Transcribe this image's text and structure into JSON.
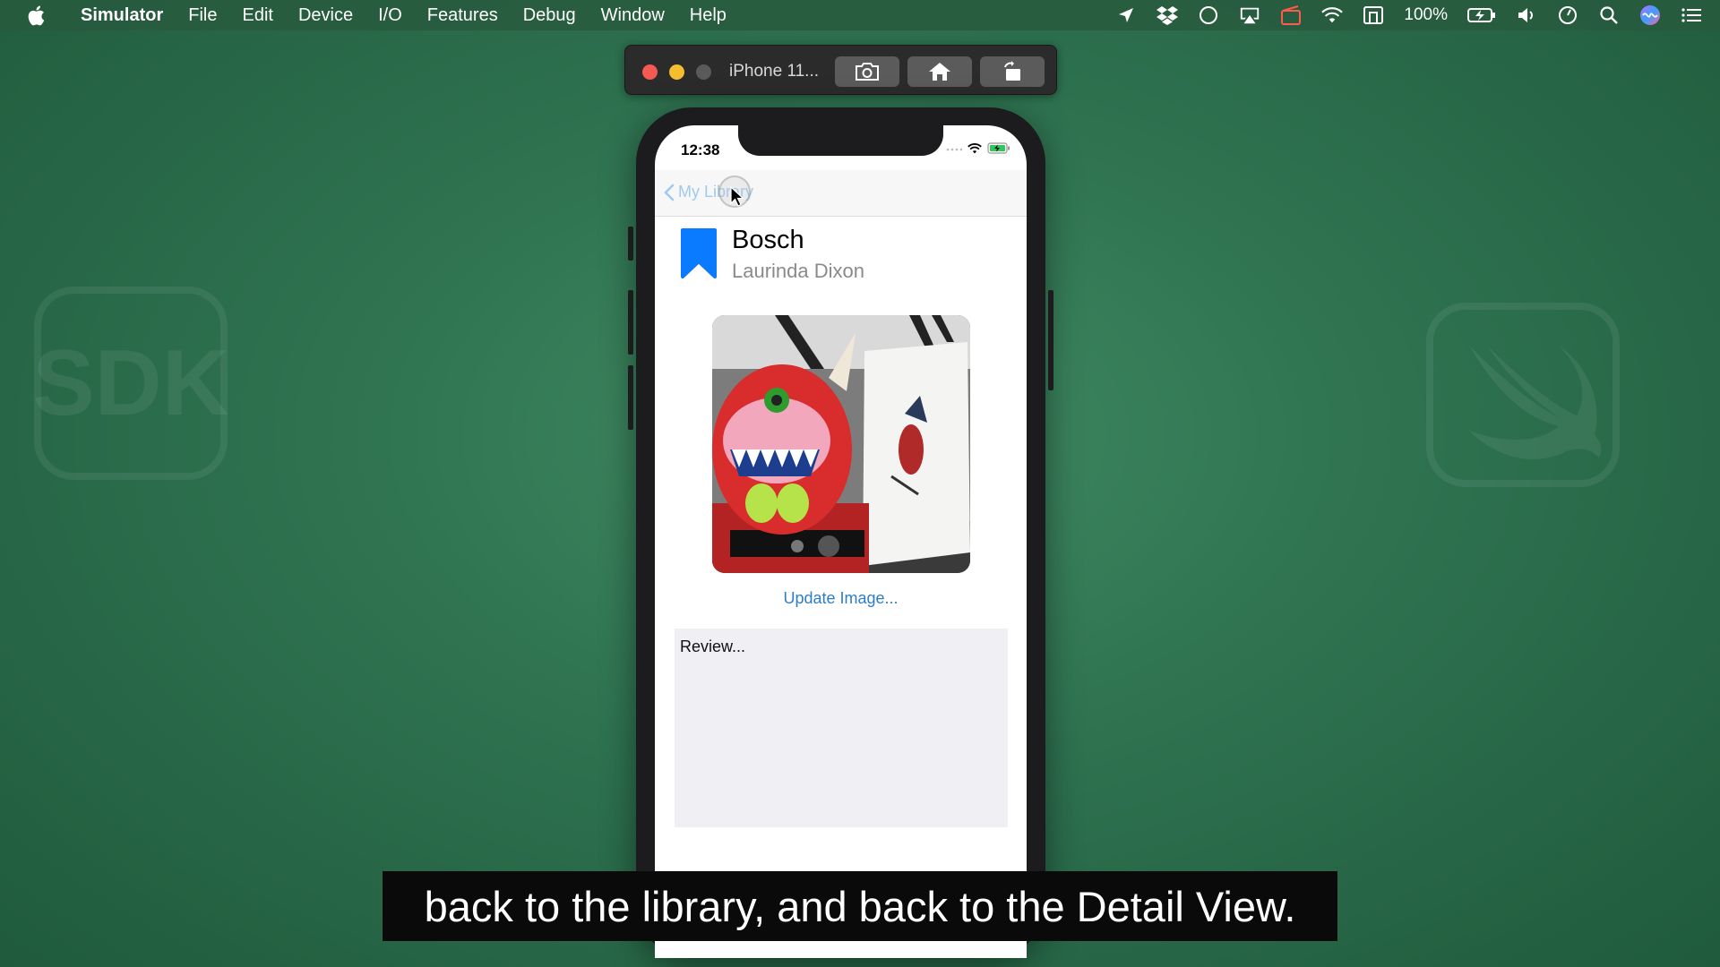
{
  "menubar": {
    "app_name": "Simulator",
    "items": [
      "File",
      "Edit",
      "Device",
      "I/O",
      "Features",
      "Debug",
      "Window",
      "Help"
    ],
    "battery_percent": "100%",
    "status_icons": [
      "location-arrow-icon",
      "dropbox-icon",
      "circle-icon",
      "airplay-icon",
      "screen-record-icon",
      "wifi-icon",
      "keyboard-input-icon",
      "battery-icon",
      "volume-icon",
      "time-machine-icon",
      "spotlight-search-icon",
      "siri-icon",
      "notification-center-icon"
    ]
  },
  "desktop": {
    "sdk_label": "SDK"
  },
  "simulator": {
    "device_title": "iPhone 11...",
    "buttons": [
      "screenshot-icon",
      "home-icon",
      "rotate-icon"
    ]
  },
  "phone": {
    "time": "12:38",
    "nav": {
      "back_label": "My Library"
    },
    "book": {
      "title": "Bosch",
      "author": "Laurinda Dixon"
    },
    "update_image_label": "Update Image...",
    "review_placeholder": "Review..."
  },
  "caption": "back to the library, and back to the Detail View.",
  "colors": {
    "desktop_green": "#2e7250",
    "accent_blue": "#2f7ec4",
    "bookmark_blue": "#0a7aff",
    "review_bg": "#efeff4"
  }
}
